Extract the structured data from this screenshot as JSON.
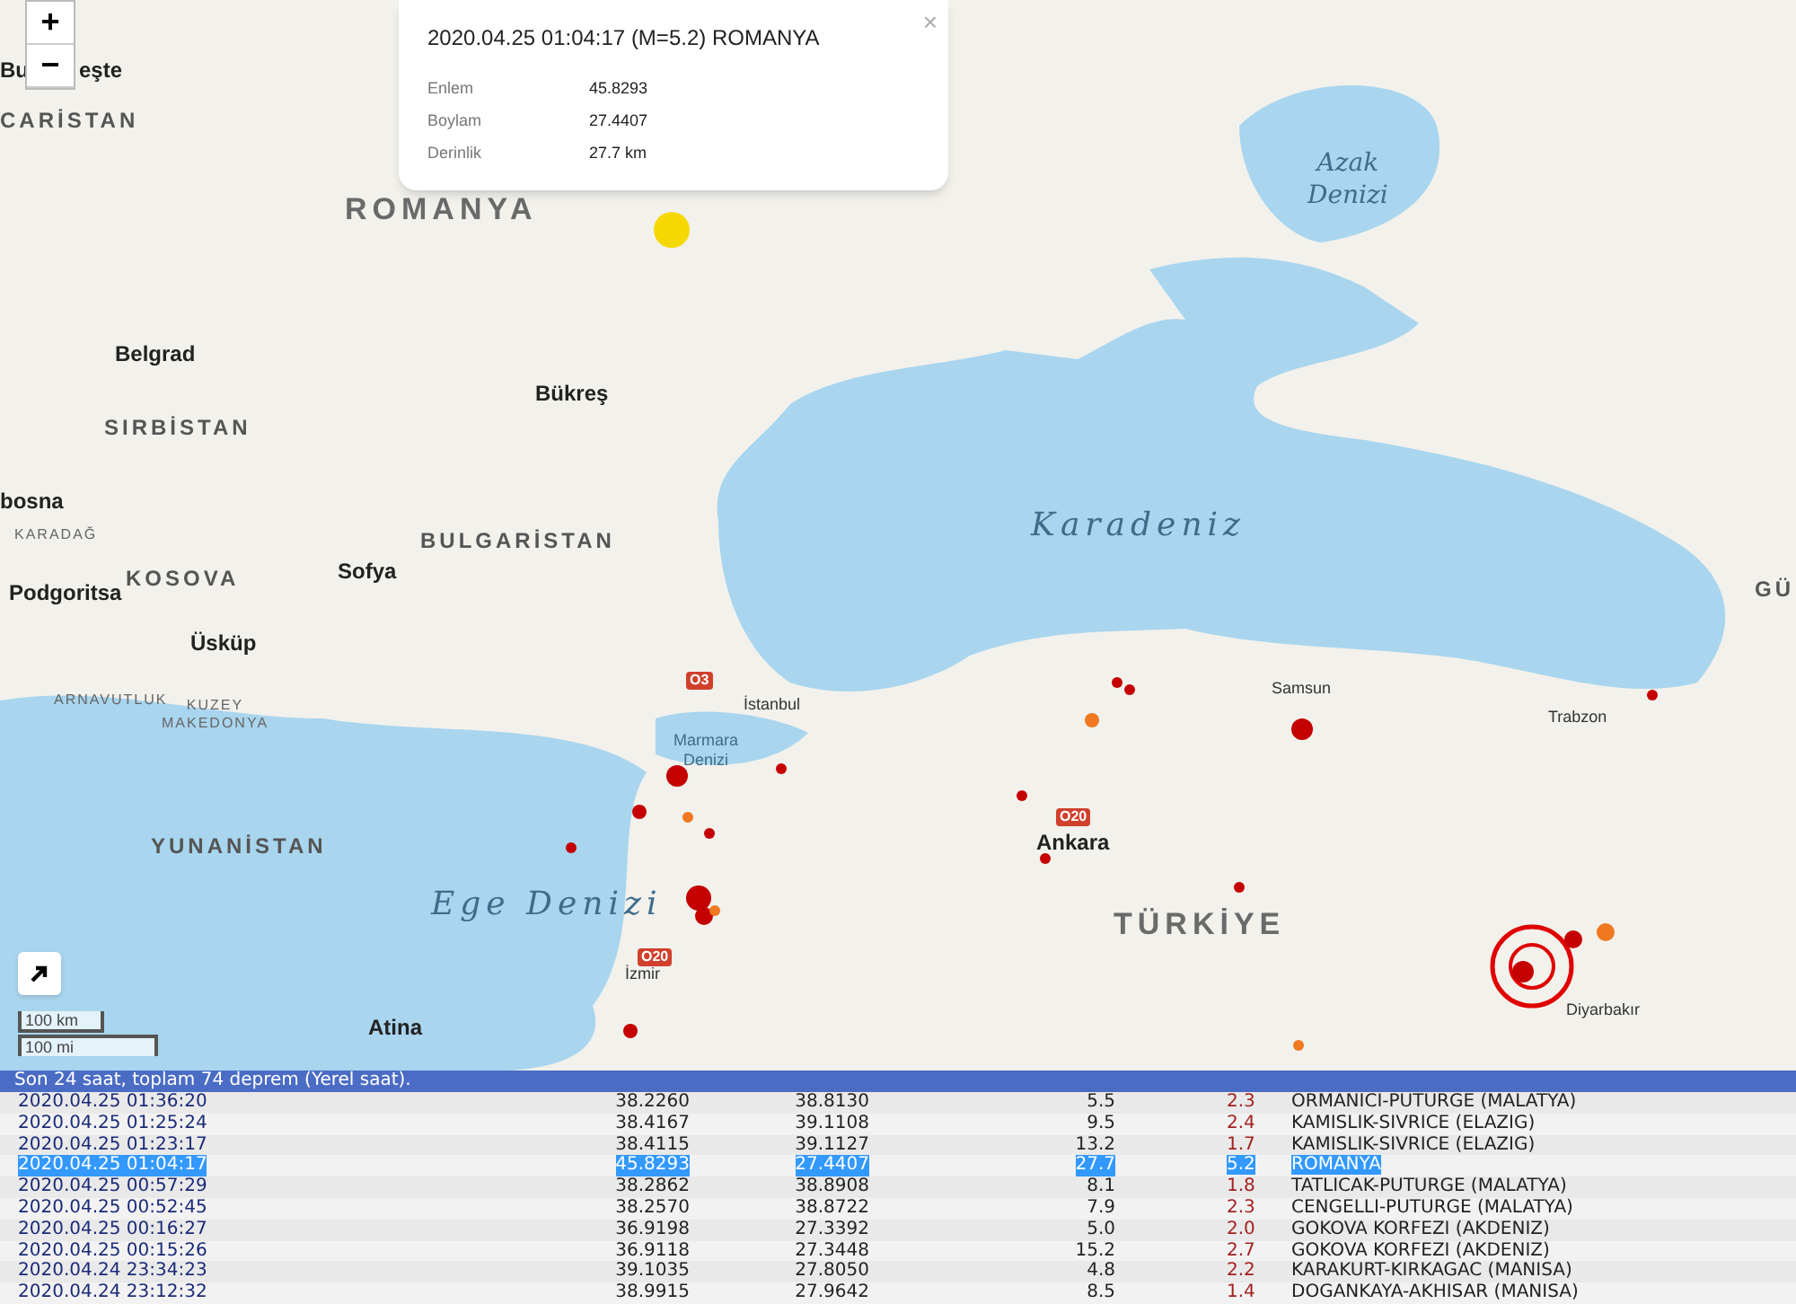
{
  "map": {
    "zoom_controls": [
      "+",
      "−"
    ],
    "labels": [
      {
        "text": "Bu",
        "kind": "city"
      },
      {
        "text": "eşte",
        "kind": "city"
      },
      {
        "text": "CARİSTAN",
        "kind": "country"
      },
      {
        "text": "ROMANYA",
        "kind": "country-big"
      },
      {
        "text": "Azak Denizi",
        "kind": "sea"
      },
      {
        "text": "Belgrad",
        "kind": "city"
      },
      {
        "text": "Bükreş",
        "kind": "city"
      },
      {
        "text": "SIRBİSTAN",
        "kind": "country"
      },
      {
        "text": "bosna",
        "kind": "city"
      },
      {
        "text": "KARADAĞ",
        "kind": "small"
      },
      {
        "text": "BULGARİSTAN",
        "kind": "country"
      },
      {
        "text": "Karadeniz",
        "kind": "sea-big"
      },
      {
        "text": "Sofya",
        "kind": "city"
      },
      {
        "text": "Podgoritsa",
        "kind": "city"
      },
      {
        "text": "KOSOVA",
        "kind": "country"
      },
      {
        "text": "Üsküp",
        "kind": "city"
      },
      {
        "text": "ARNAVUTLUK",
        "kind": "small"
      },
      {
        "text": "KUZEY MAKEDONYA",
        "kind": "small"
      },
      {
        "text": "GÜ",
        "kind": "country"
      },
      {
        "text": "Samsun",
        "kind": "small-city"
      },
      {
        "text": "Trabzon",
        "kind": "small-city"
      },
      {
        "text": "İstanbul",
        "kind": "small-city"
      },
      {
        "text": "Marmara Denizi",
        "kind": "sea-small"
      },
      {
        "text": "YUNANİSTAN",
        "kind": "country"
      },
      {
        "text": "Ankara",
        "kind": "city"
      },
      {
        "text": "TÜRKİYE",
        "kind": "country-big"
      },
      {
        "text": "Ege Denizi",
        "kind": "sea-big"
      },
      {
        "text": "İzmir",
        "kind": "small-city"
      },
      {
        "text": "Atina",
        "kind": "city"
      },
      {
        "text": "Diyarbakır",
        "kind": "small-city"
      }
    ],
    "road_shields": [
      "O3",
      "O20",
      "O20"
    ],
    "quakes": [
      {
        "color": "#c40000"
      },
      {
        "color": "#c40000"
      },
      {
        "color": "#c40000"
      },
      {
        "color": "#c40000"
      },
      {
        "color": "#c40000"
      },
      {
        "color": "#c40000"
      },
      {
        "color": "#c40000"
      },
      {
        "color": "#c40000"
      },
      {
        "color": "#c40000"
      },
      {
        "color": "#c40000"
      },
      {
        "color": "#c40000"
      },
      {
        "color": "#c40000"
      },
      {
        "color": "#c40000"
      },
      {
        "color": "#c40000"
      },
      {
        "color": "#c40000"
      },
      {
        "color": "#c40000"
      },
      {
        "color": "#c40000"
      },
      {
        "color": "#f07820"
      },
      {
        "color": "#f07820"
      },
      {
        "color": "#f07820"
      },
      {
        "color": "#f07820"
      },
      {
        "color": "#f07820"
      },
      {
        "color": "#f5d800"
      }
    ],
    "popup": {
      "title": "2020.04.25 01:04:17 (M=5.2) ROMANYA",
      "close": "×",
      "fields": [
        {
          "label": "Enlem",
          "value": "45.8293"
        },
        {
          "label": "Boylam",
          "value": "27.4407"
        },
        {
          "label": "Derinlik",
          "value": "27.7 km"
        }
      ]
    },
    "scale": [
      "100 km",
      "100 mi"
    ]
  },
  "table": {
    "caption": "Son 24 saat, toplam 74 deprem (Yerel saat).",
    "rows": [
      {
        "time": "2020.04.25 01:36:20",
        "lat": "38.2260",
        "lon": "38.8130",
        "depth": "5.5",
        "mag": "2.3",
        "place": "ORMANICI-PUTURGE (MALATYA)",
        "selected": false
      },
      {
        "time": "2020.04.25 01:25:24",
        "lat": "38.4167",
        "lon": "39.1108",
        "depth": "9.5",
        "mag": "2.4",
        "place": "KAMISLIK-SIVRICE (ELAZIG)",
        "selected": false
      },
      {
        "time": "2020.04.25 01:23:17",
        "lat": "38.4115",
        "lon": "39.1127",
        "depth": "13.2",
        "mag": "1.7",
        "place": "KAMISLIK-SIVRICE (ELAZIG)",
        "selected": false
      },
      {
        "time": "2020.04.25 01:04:17",
        "lat": "45.8293",
        "lon": "27.4407",
        "depth": "27.7",
        "mag": "5.2",
        "place": "ROMANYA",
        "selected": true
      },
      {
        "time": "2020.04.25 00:57:29",
        "lat": "38.2862",
        "lon": "38.8908",
        "depth": "8.1",
        "mag": "1.8",
        "place": "TATLICAK-PUTURGE (MALATYA)",
        "selected": false
      },
      {
        "time": "2020.04.25 00:52:45",
        "lat": "38.2570",
        "lon": "38.8722",
        "depth": "7.9",
        "mag": "2.3",
        "place": "CENGELLI-PUTURGE (MALATYA)",
        "selected": false
      },
      {
        "time": "2020.04.25 00:16:27",
        "lat": "36.9198",
        "lon": "27.3392",
        "depth": "5.0",
        "mag": "2.0",
        "place": "GOKOVA KORFEZI (AKDENIZ)",
        "selected": false
      },
      {
        "time": "2020.04.25 00:15:26",
        "lat": "36.9118",
        "lon": "27.3448",
        "depth": "15.2",
        "mag": "2.7",
        "place": "GOKOVA KORFEZI (AKDENIZ)",
        "selected": false
      },
      {
        "time": "2020.04.24 23:34:23",
        "lat": "39.1035",
        "lon": "27.8050",
        "depth": "4.8",
        "mag": "2.2",
        "place": "KARAKURT-KIRKAGAC (MANISA)",
        "selected": false
      },
      {
        "time": "2020.04.24 23:12:32",
        "lat": "38.9915",
        "lon": "27.9642",
        "depth": "8.5",
        "mag": "1.4",
        "place": "DOGANKAYA-AKHISAR (MANISA)",
        "selected": false
      }
    ]
  }
}
